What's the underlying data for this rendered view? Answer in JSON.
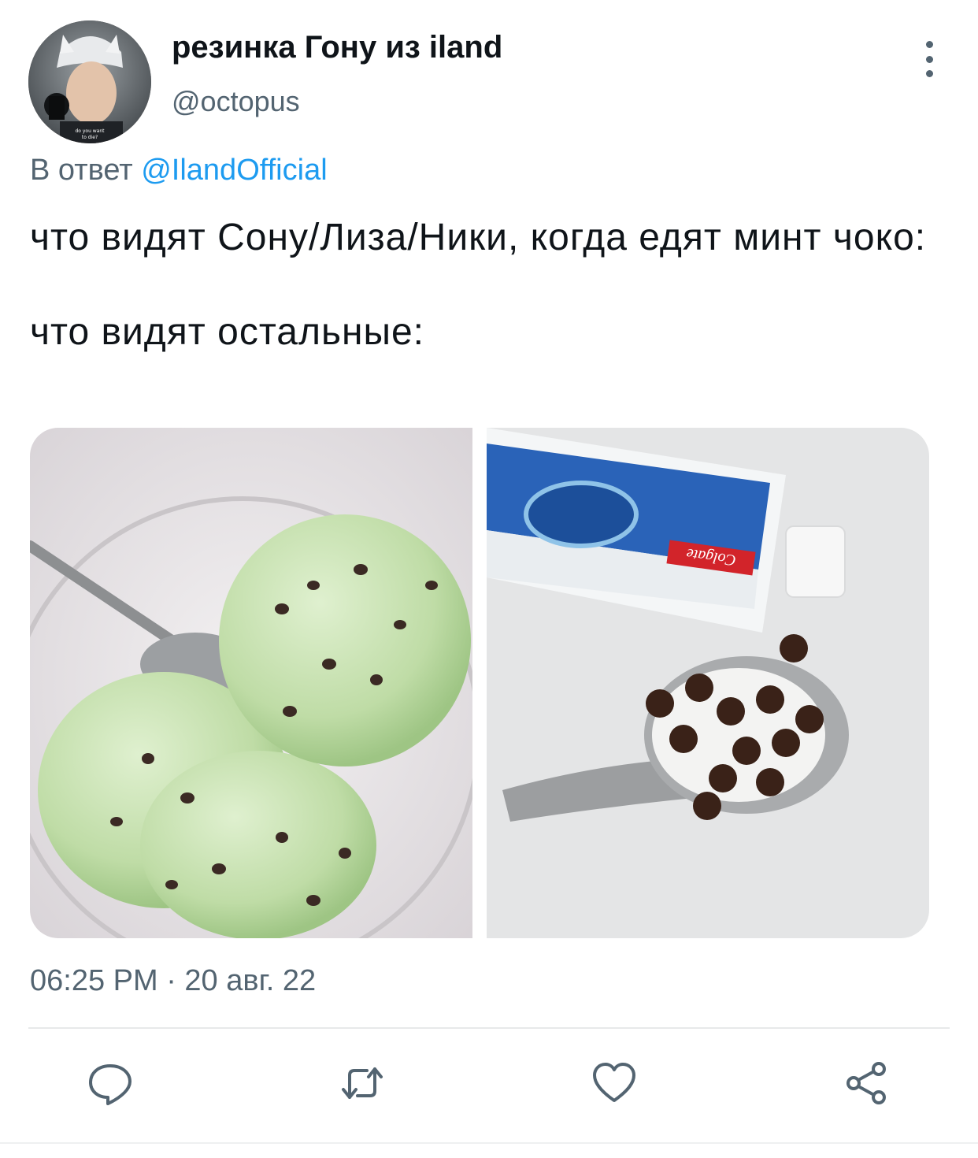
{
  "author": {
    "display_name": "резинка Гону из iland",
    "handle": "@octopus",
    "avatar_caption": "do you want to die?"
  },
  "reply": {
    "prefix": "В ответ",
    "mention": "@IlandOfficial"
  },
  "tweet": {
    "line1": "что видят Сону/Лиза/Ники, когда едят минт чоко:",
    "line2": "что видят остальные:"
  },
  "media": [
    {
      "name": "mint-chocolate-ice-cream-photo",
      "alt": "mint choco ice cream"
    },
    {
      "name": "toothpaste-with-chocolate-chips-photo",
      "alt": "Colgate",
      "brand_text": "Colgate"
    }
  ],
  "meta": {
    "timestamp": "06:25 PM · 20 авг. 22"
  },
  "actions": {
    "reply_icon": "speech-bubble-icon",
    "retweet_icon": "retweet-icon",
    "like_icon": "heart-icon",
    "share_icon": "share-icon"
  },
  "colors": {
    "link": "#1d9bf0",
    "secondary_text": "#536471",
    "primary_text": "#0f1419",
    "divider": "#e7e9ea"
  }
}
